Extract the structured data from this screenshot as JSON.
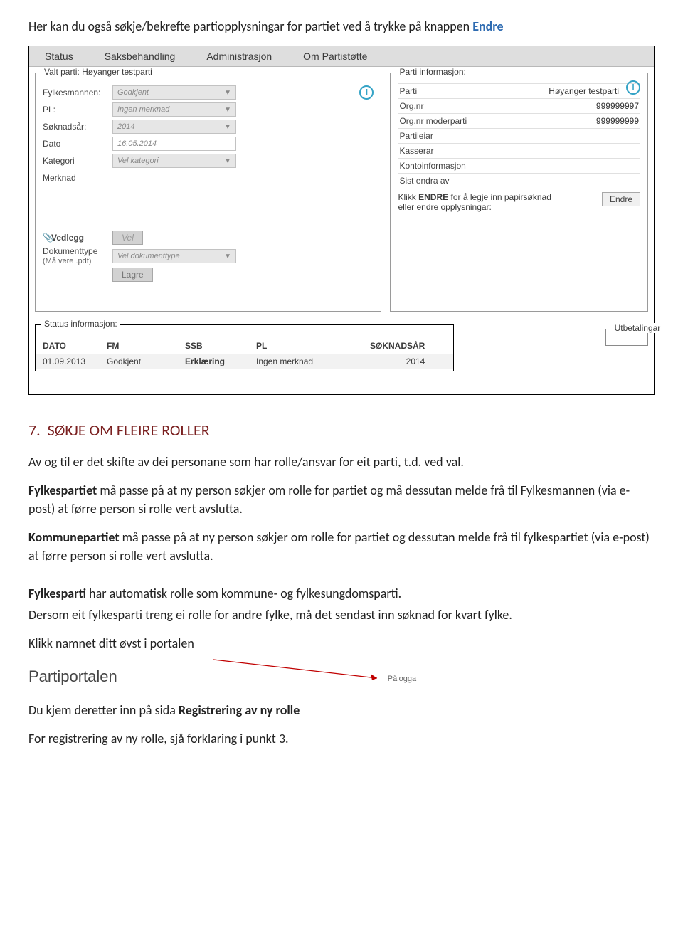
{
  "doc": {
    "intro_a": "Her kan du også søkje/bekrefte partiopplysningar for partiet ved å trykke på knappen ",
    "intro_b": "Endre",
    "h2_num": "7.",
    "h2_text": "SØKJE OM FLEIRE ROLLER",
    "p1": "Av og til er det skifte av dei personane som har rolle/ansvar for eit parti, t.d. ved val.",
    "p2_b": "Fylkespartiet",
    "p2": " må passe på at ny person søkjer om rolle for partiet og må dessutan melde frå til Fylkesmannen (via e-post) at førre person si rolle vert avslutta.",
    "p3_b": "Kommunepartiet",
    "p3": " må passe på at ny person søkjer om rolle for partiet og dessutan melde frå til fylkespartiet (via e-post) at førre person si rolle vert avslutta.",
    "p4_b": "Fylkesparti",
    "p4": " har automatisk rolle som kommune- og fylkesungdomsparti.",
    "p5": "Dersom eit fylkesparti treng ei rolle for andre fylke, må det sendast inn søknad for kvart fylke.",
    "p6": "Klikk namnet ditt øvst i portalen",
    "p7_a": "Du kjem deretter inn på sida ",
    "p7_b": "Registrering av ny rolle",
    "p8": "For registrering av ny rolle, sjå forklaring i punkt 3."
  },
  "shot": {
    "tabs": [
      "Status",
      "Saksbehandling",
      "Administrasjon",
      "Om Partistøtte"
    ],
    "left_legend": "Valt parti: Høyanger testparti",
    "left_rows": {
      "fylkesmannen": {
        "label": "Fylkesmannen:",
        "value": "Godkjent"
      },
      "pl": {
        "label": "PL:",
        "value": "Ingen merknad"
      },
      "soknadsar": {
        "label": "Søknadsår:",
        "value": "2014"
      },
      "dato": {
        "label": "Dato",
        "value": "16.05.2014"
      },
      "kategori": {
        "label": "Kategori",
        "value": "Vel kategori"
      },
      "merknad": {
        "label": "Merknad"
      }
    },
    "attach": {
      "vedlegg": "Vedlegg",
      "vel": "Vel",
      "dtype": "Dokumenttype",
      "dnote": "(Må vere .pdf)",
      "dvalue": "Vel dokumenttype",
      "lagre": "Lagre"
    },
    "right_legend": "Parti informasjon:",
    "right": [
      {
        "k": "Parti",
        "v": "Høyanger testparti"
      },
      {
        "k": "Org.nr",
        "v": "999999997"
      },
      {
        "k": "Org.nr moderparti",
        "v": "999999999"
      },
      {
        "k": "Partileiar",
        "v": ""
      },
      {
        "k": "Kasserar",
        "v": ""
      },
      {
        "k": "Kontoinformasjon",
        "v": ""
      },
      {
        "k": "Sist endra av",
        "v": ""
      }
    ],
    "endre_note_a": "Klikk ",
    "endre_note_b": "ENDRE",
    "endre_note_c": " for å legje inn papirsøknad eller endre opplysningar:",
    "endre_btn": "Endre",
    "status_legend": "Status informasjon:",
    "status_head": [
      "DATO",
      "FM",
      "SSB",
      "PL",
      "SØKNADSÅR"
    ],
    "status_row": [
      "01.09.2013",
      "Godkjent",
      "Erklæring",
      "Ingen merknad",
      "2014"
    ],
    "utbet": "Utbetalingar"
  },
  "mini": {
    "title": "Partiportalen",
    "right": "Pålogga"
  }
}
